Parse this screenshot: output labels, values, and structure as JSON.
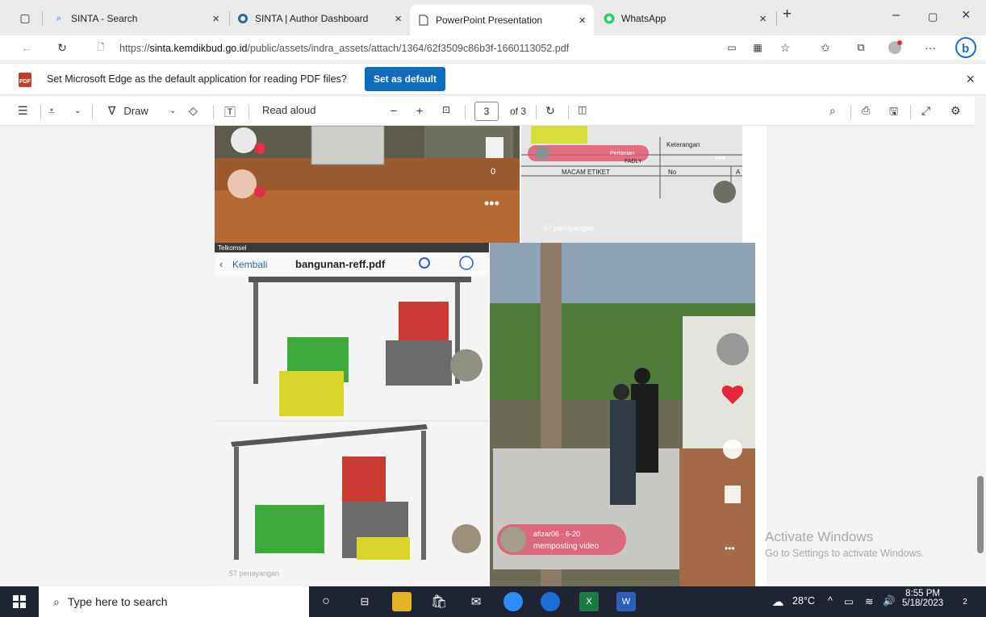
{
  "tabs": [
    {
      "label": "SINTA - Search",
      "icon": "search-icon"
    },
    {
      "label": "SINTA | Author Dashboard",
      "icon": "sinta-icon"
    },
    {
      "label": "PowerPoint Presentation",
      "icon": "document-icon"
    },
    {
      "label": "WhatsApp",
      "icon": "whatsapp-icon"
    }
  ],
  "address": {
    "prefix": "https://",
    "host": "sinta.kemdikbud.go.id",
    "path": "/public/assets/indra_assets/attach/1364/62f3509c86b3f-1660113052.pdf"
  },
  "infobar": {
    "message": "Set Microsoft Edge as the default application for reading PDF files?",
    "button": "Set as default"
  },
  "pdf_toolbar": {
    "draw": "Draw",
    "read_aloud": "Read aloud",
    "page": "3",
    "of": "of 3"
  },
  "content": {
    "top_right": {
      "rows": [
        "Keterangan",
        "MACAM ETIKET",
        "No",
        "A"
      ],
      "label": "Pertanian",
      "author_line": "FADLY",
      "views": "57 penayangan"
    },
    "top_left": {
      "likes": "0"
    },
    "mobile": {
      "status": "Telkomsel",
      "back": "Kembali",
      "file": "bangunan-reff.pdf",
      "views": "57 penayangan"
    },
    "video": {
      "user": "afizar06 · 6-20",
      "action": "memposting video"
    },
    "colors": {
      "red": "#c93a32",
      "green": "#3daa3a",
      "yellow": "#d9d52a",
      "grey": "#6b6b6b"
    }
  },
  "watermark": {
    "line1": "Activate Windows",
    "line2": "Go to Settings to activate Windows."
  },
  "taskbar": {
    "search_placeholder": "Type here to search",
    "temperature": "28°C",
    "time": "8:55 PM",
    "date": "5/18/2023",
    "notification_count": "2"
  }
}
